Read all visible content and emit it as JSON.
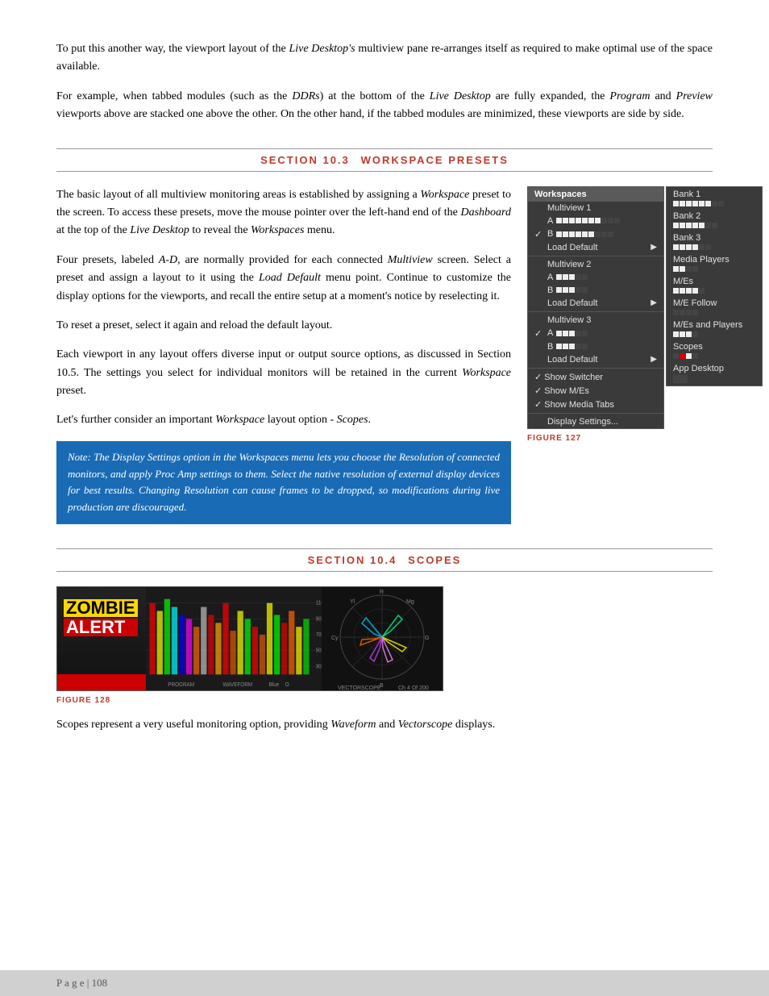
{
  "page": {
    "number": "108"
  },
  "intro": {
    "para1": "To put this another way, the viewport layout of the Live Desktop's multiview pane re-arranges itself as required to make optimal use of the space available.",
    "para2": "For example, when tabbed modules (such as the DDRs) at the bottom of the Live Desktop are fully expanded, the Program and Preview viewports above are stacked one above the other.  On the other hand, if the tabbed modules are minimized, these viewports are side by side."
  },
  "section103": {
    "number": "SECTION 10.3",
    "title": "WORKSPACE PRESETS",
    "para1": "The basic layout of all multiview monitoring areas is established by assigning a Workspace preset to the screen.  To access these presets, move the mouse pointer over the left-hand end of the Dashboard at the top of the Live Desktop to reveal the Workspaces menu.",
    "para2": "Four presets, labeled A-D, are normally provided for each connected Multiview screen.  Select a preset and assign a layout to it using the Load Default menu point.  Continue to customize the display options for the viewports, and recall the entire setup at a moment's notice by reselecting it.",
    "para3": "To reset a preset, select it again and reload the default layout.",
    "para4": "Each viewport in any layout offers diverse input or output source options, as discussed in Section 10.5.  The settings you select for individual monitors will be retained in the current Workspace preset.",
    "para5": "Let's further consider an important Workspace layout option - Scopes.",
    "note": "Note: The Display Settings option in the Workspaces menu lets you choose the Resolution of connected monitors, and apply Proc Amp settings to them. Select the native resolution of external display devices for best results. Changing Resolution can cause frames to be dropped, so modifications during live production are discouraged.",
    "figure127": "FIGURE 127"
  },
  "workspace_menu": {
    "header": "Workspaces",
    "multiview1": "Multiview 1",
    "preset_a1": "A",
    "preset_b1": "B",
    "load_default1": "Load Default",
    "multiview2": "Multiview 2",
    "preset_a2": "A",
    "preset_b2": "B",
    "load_default2": "Load Default",
    "multiview3": "Multiview 3",
    "preset_a3": "A",
    "preset_b3": "B",
    "load_default3": "Load Default",
    "show_switcher": "✓ Show Switcher",
    "show_mes": "✓ Show M/Es",
    "show_media_tabs": "✓ Show Media Tabs",
    "display_settings": "Display Settings..."
  },
  "submenu": {
    "bank1": "Bank 1",
    "bank2": "Bank 2",
    "bank3": "Bank 3",
    "media_players": "Media Players",
    "mes": "M/Es",
    "me_follow": "M/E Follow",
    "mes_and_players": "M/Es and Players",
    "scopes": "Scopes",
    "app_desktop": "App Desktop"
  },
  "section104": {
    "number": "SECTION 10.4",
    "title": "SCOPES",
    "figure128": "FIGURE 128",
    "para1": "Scopes represent a very useful monitoring option, providing Waveform and Vectorscope displays."
  }
}
